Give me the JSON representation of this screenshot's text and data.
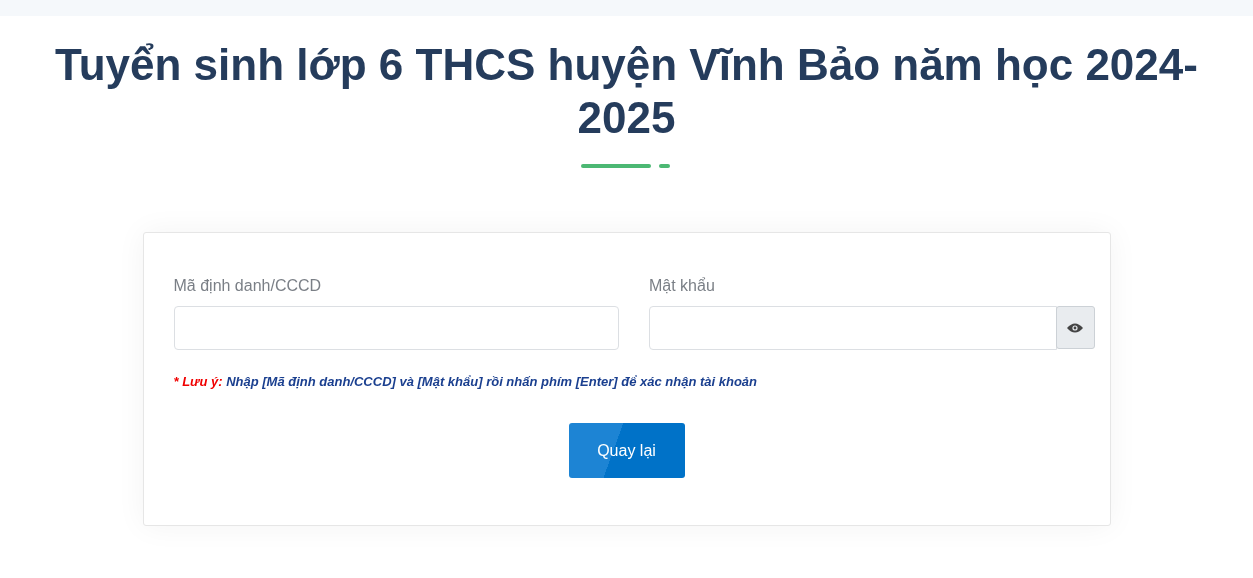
{
  "title": "Tuyển sinh lớp 6 THCS huyện Vĩnh Bảo năm học 2024-2025",
  "fields": [
    {
      "label": "Mã định danh/CCCD",
      "kind": "text"
    },
    {
      "label": "Mật khẩu",
      "kind": "password"
    }
  ],
  "note": {
    "mark": "* Lưu ý:",
    "text": "Nhập [Mã định danh/CCCD] và [Mật khẩu] rồi nhấn phím [Enter] để xác nhận tài khoản"
  },
  "button": "Quay lại"
}
